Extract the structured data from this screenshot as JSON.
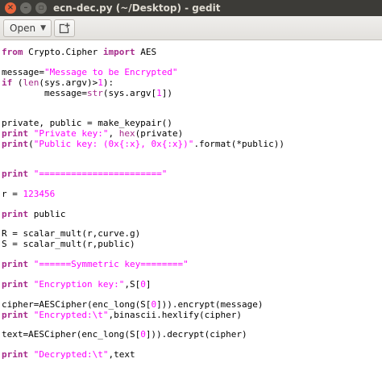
{
  "window": {
    "title": "ecn-dec.py (~/Desktop) - gedit",
    "close_glyph": "×",
    "minimize_glyph": "–",
    "maximize_glyph": "▫"
  },
  "toolbar": {
    "open_label": "Open",
    "open_arrow": "▼",
    "new_document_icon": "new-document-icon"
  },
  "colors": {
    "keyword": "#a52a8a",
    "string": "#ff00ff",
    "titlebar": "#3c3b37",
    "close_button": "#e9643b"
  },
  "code": {
    "l1": [
      "from",
      " Crypto.Cipher ",
      "import",
      " AES"
    ],
    "l3": [
      "message=",
      "\"Message to be Encrypted\""
    ],
    "l4": [
      "if",
      " (",
      "len",
      "(sys.argv)>",
      "1",
      "):"
    ],
    "l5": [
      "        message=",
      "str",
      "(sys.argv[",
      "1",
      "])"
    ],
    "l8": [
      "private, public = make_keypair()"
    ],
    "l9": [
      "print",
      " ",
      "\"Private key:\"",
      ", ",
      "hex",
      "(private)"
    ],
    "l10": [
      "print",
      "(",
      "\"Public key: (0x{:x}, 0x{:x})\"",
      ".format(*public))"
    ],
    "l13": [
      "print",
      " ",
      "\"=======================\""
    ],
    "l15": [
      "r = ",
      "123456"
    ],
    "l17": [
      "print",
      " public"
    ],
    "l19": [
      "R = scalar_mult(r,curve.g)"
    ],
    "l20": [
      "S = scalar_mult(r,public)"
    ],
    "l22": [
      "print",
      " ",
      "\"======Symmetric key========\""
    ],
    "l24": [
      "print",
      " ",
      "\"Encryption key:\"",
      ",S[",
      "0",
      "]"
    ],
    "l26": [
      "cipher=AESCipher(enc_long(S[",
      "0",
      "])).encrypt(message)"
    ],
    "l27": [
      "print",
      " ",
      "\"Encrypted:\\t\"",
      ",binascii.hexlify(cipher)"
    ],
    "l29": [
      "text=AESCipher(enc_long(S[",
      "0",
      "])).decrypt(cipher)"
    ],
    "l31": [
      "print",
      " ",
      "\"Decrypted:\\t\"",
      ",text"
    ]
  }
}
